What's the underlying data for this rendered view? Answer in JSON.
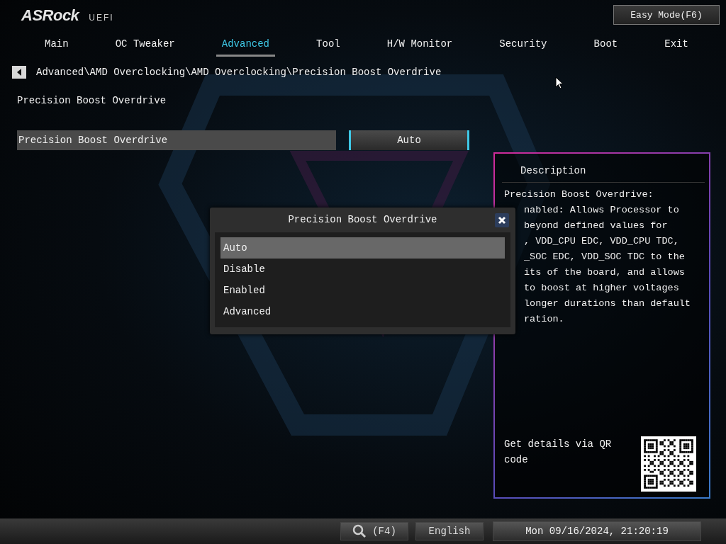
{
  "logo": {
    "brand": "ASRock",
    "suffix": "UEFI"
  },
  "easy_mode_button": "Easy Mode(F6)",
  "tabs": [
    {
      "label": "Main",
      "selected": false
    },
    {
      "label": "OC Tweaker",
      "selected": false
    },
    {
      "label": "Advanced",
      "selected": true
    },
    {
      "label": "Tool",
      "selected": false
    },
    {
      "label": "H/W Monitor",
      "selected": false
    },
    {
      "label": "Security",
      "selected": false
    },
    {
      "label": "Boot",
      "selected": false
    },
    {
      "label": "Exit",
      "selected": false
    }
  ],
  "breadcrumb": "Advanced\\AMD Overclocking\\AMD Overclocking\\Precision Boost Overdrive",
  "section_title": "Precision Boost Overdrive",
  "settings": [
    {
      "label": "Precision Boost Overdrive",
      "value": "Auto"
    }
  ],
  "description": {
    "title": "Description",
    "lines": [
      {
        "text": "Precision Boost Overdrive:",
        "covered": false
      },
      {
        "text": "nabled: Allows Processor to",
        "covered": true
      },
      {
        "text": "beyond defined values for",
        "covered": true
      },
      {
        "text": ", VDD_CPU EDC, VDD_CPU TDC,",
        "covered": true
      },
      {
        "text": "_SOC EDC, VDD_SOC TDC to the",
        "covered": true
      },
      {
        "text": "its of the board, and allows",
        "covered": true
      },
      {
        "text": "to boost at higher voltages",
        "covered": true
      },
      {
        "text": "longer durations than default",
        "covered": true
      },
      {
        "text": "ration.",
        "covered": true
      }
    ],
    "qr_text": "Get details via QR code"
  },
  "dialog": {
    "title": "Precision Boost Overdrive",
    "options": [
      {
        "label": "Auto",
        "selected": true
      },
      {
        "label": "Disable",
        "selected": false
      },
      {
        "label": "Enabled",
        "selected": false
      },
      {
        "label": "Advanced",
        "selected": false
      }
    ]
  },
  "status_bar": {
    "search_key": "(F4)",
    "language": "English",
    "datetime": "Mon 09/16/2024, 21:20:19"
  }
}
